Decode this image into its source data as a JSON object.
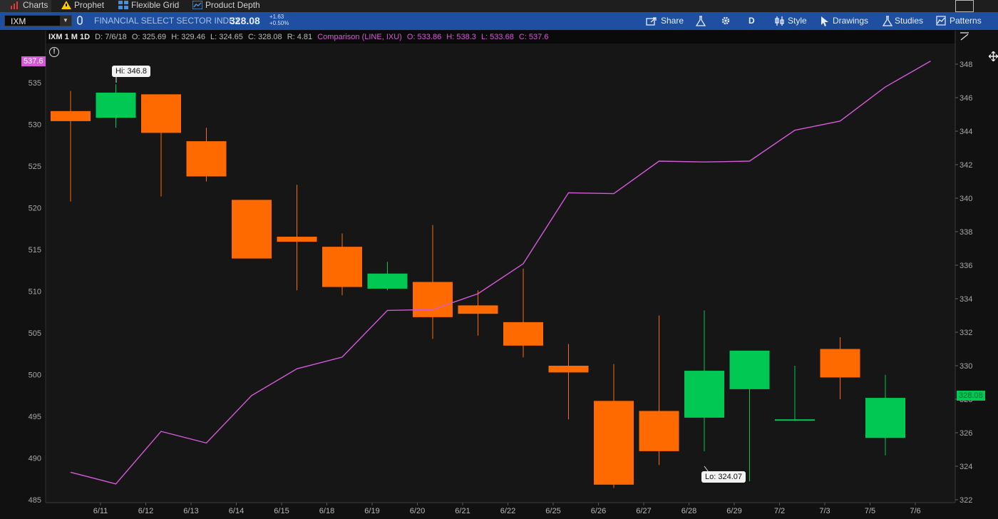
{
  "nav": {
    "tabs": [
      {
        "label": "Charts",
        "icon": "chart-bars-icon"
      },
      {
        "label": "Prophet",
        "icon": "prophet-triangle-icon"
      },
      {
        "label": "Flexible Grid",
        "icon": "grid-icon"
      },
      {
        "label": "Product Depth",
        "icon": "depth-icon"
      }
    ]
  },
  "toolbar": {
    "symbol": "IXM",
    "description": "FINANCIAL SELECT SECTOR INDEX",
    "price": "328.08",
    "change": "+1.63",
    "change_pct": "+0.50%",
    "share_label": "Share",
    "period_label": "D",
    "style_label": "Style",
    "drawings_label": "Drawings",
    "studies_label": "Studies",
    "patterns_label": "Patterns"
  },
  "infobar": {
    "symbol_period": "IXM 1 M 1D",
    "date": "D: 7/6/18",
    "open": "O: 325.69",
    "high": "H: 329.46",
    "low": "L: 324.65",
    "close": "C: 328.08",
    "range": "R: 4.81",
    "comparison": "Comparison (LINE, IXU)",
    "cmp_open": "O: 533.86",
    "cmp_high": "H: 538.3",
    "cmp_low": "L: 533.68",
    "cmp_close": "C: 537.6"
  },
  "annotations": {
    "hi": "Hi: 346.8",
    "lo": "Lo: 324.07",
    "left_last": "537.6",
    "right_last": "328.08"
  },
  "colors": {
    "up": "#00c853",
    "down": "#ff6a00",
    "compare": "#d45ad8",
    "accent": "#1e4fa0"
  },
  "chart_data": {
    "type": "candlestick",
    "categories": [
      "6/11",
      "6/12",
      "6/13",
      "6/14",
      "6/15",
      "6/18",
      "6/19",
      "6/20",
      "6/21",
      "6/22",
      "6/25",
      "6/26",
      "6/27",
      "6/28",
      "6/29",
      "7/2",
      "7/3",
      "7/5",
      "7/6"
    ],
    "ohlc": [
      [
        345.2,
        346.4,
        339.8,
        344.6
      ],
      [
        344.8,
        346.8,
        344.2,
        346.3
      ],
      [
        346.2,
        346.2,
        340.1,
        343.9
      ],
      [
        343.4,
        344.2,
        341.0,
        341.3
      ],
      [
        339.9,
        339.9,
        336.4,
        336.4
      ],
      [
        337.7,
        340.8,
        334.5,
        337.4
      ],
      [
        337.1,
        337.9,
        334.2,
        334.7
      ],
      [
        334.6,
        336.2,
        334.5,
        335.5
      ],
      [
        335.0,
        338.4,
        331.6,
        332.9
      ],
      [
        333.6,
        334.5,
        331.8,
        333.1
      ],
      [
        332.6,
        335.8,
        330.5,
        331.2
      ],
      [
        330.0,
        331.3,
        326.8,
        329.6
      ],
      [
        327.9,
        330.1,
        322.7,
        322.9
      ],
      [
        327.3,
        333.0,
        324.07,
        324.9
      ],
      [
        326.9,
        333.3,
        324.9,
        329.7
      ],
      [
        328.6,
        328.6,
        323.1,
        330.9
      ],
      [
        326.8,
        330.0,
        326.7,
        326.8
      ],
      [
        331.0,
        331.7,
        328.0,
        329.3
      ],
      [
        325.69,
        329.46,
        324.65,
        328.08
      ]
    ],
    "comparison": {
      "name": "IXU",
      "values": [
        488.3,
        486.9,
        493.2,
        491.8,
        497.5,
        500.7,
        502.1,
        507.7,
        507.8,
        509.7,
        513.3,
        521.8,
        521.7,
        525.6,
        525.5,
        525.6,
        529.3,
        530.4,
        534.5,
        537.6
      ]
    },
    "left_axis": {
      "ticks": [
        485,
        490,
        495,
        500,
        505,
        510,
        515,
        520,
        525,
        530,
        535
      ],
      "range": [
        485.0,
        537.6
      ]
    },
    "right_axis": {
      "ticks": [
        322,
        324,
        326,
        328,
        330,
        332,
        334,
        336,
        338,
        340,
        342,
        344,
        346,
        348
      ],
      "range": [
        322.0,
        348.0
      ]
    }
  }
}
